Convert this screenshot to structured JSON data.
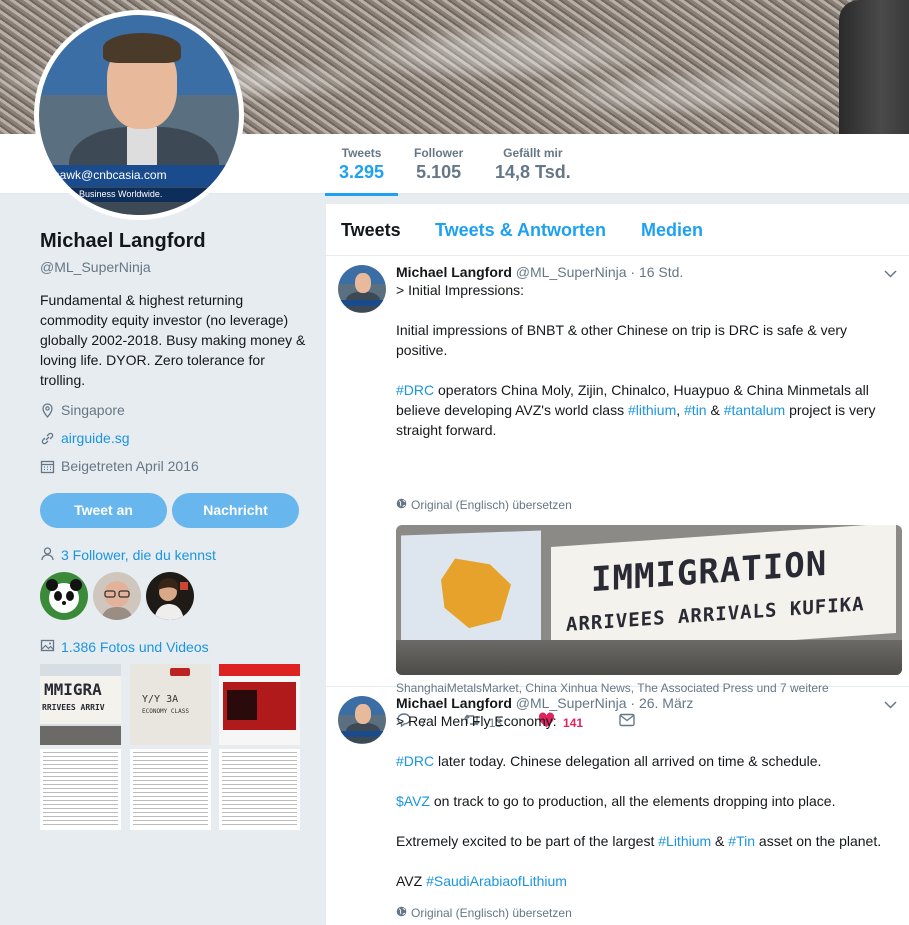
{
  "profile": {
    "name": "Michael Langford",
    "handle": "@ML_SuperNinja",
    "bio": "Fundamental & highest returning commodity equity investor (no leverage) globally 2002-2018. Busy making money & loving life. DYOR. Zero tolerance for trolling.",
    "location": "Singapore",
    "website": "airguide.sg",
    "joined": "Beigetreten April 2016",
    "avatar_ticker": "hawk@cnbcasia.com",
    "avatar_ticker_sub": "Business Worldwide.",
    "tweet_button": "Tweet an",
    "message_button": "Nachricht",
    "followers_you_know": "3 Follower, die du kennst",
    "photos_videos": "1.386 Fotos und Videos"
  },
  "stats": [
    {
      "label": "Tweets",
      "value": "3.295"
    },
    {
      "label": "Follower",
      "value": "5.105"
    },
    {
      "label": "Gefällt mir",
      "value": "14,8 Tsd."
    }
  ],
  "tabs": [
    "Tweets",
    "Tweets & Antworten",
    "Medien"
  ],
  "media_thumbs": {
    "thumb1": "MMIGRA",
    "thumb1b": "RRIVEES ARRIV",
    "thumb2": "Y/Y 3A",
    "thumb2b": "ECONOMY CLASS"
  },
  "tweets": [
    {
      "name": "Michael Langford",
      "handle": "@ML_SuperNinja",
      "time": "· 16 Std.",
      "line1": "> Initial Impressions:",
      "line2": "Initial impressions of BNBT & other Chinese on trip is DRC is safe & very positive.",
      "p3_tag1": "#DRC",
      "p3_a": " operators China Moly, Zijin, Chinalco, Huaypuo & China Minmetals all believe developing AVZ's world class ",
      "p3_tag2": "#lithium",
      "p3_b": ", ",
      "p3_tag3": "#tin",
      "p3_c": " & ",
      "p3_tag4": "#tantalum",
      "p3_d": " project is very straight forward.",
      "translate": "Original (Englisch) übersetzen",
      "media_line1": "IMMIGRATION",
      "media_line2": "ARRIVEES ARRIVALS KUFIKA",
      "credits": "ShanghaiMetalsMarket, China Xinhua News, The Associated Press und 7 weitere",
      "replies": "7",
      "retweets": "13",
      "likes": "141"
    },
    {
      "name": "Michael Langford",
      "handle": "@ML_SuperNinja",
      "time": "· 26. März",
      "line1": "> Real Men Fly Economy:",
      "p2_tag": "#DRC",
      "p2_text": " later today. Chinese delegation all arrived on time & schedule.",
      "p3_tag": "$AVZ",
      "p3_text": " on track to go to production, all the elements dropping into place.",
      "p4_a": "Extremely excited to be part of the largest ",
      "p4_tag1": "#Lithium",
      "p4_b": " & ",
      "p4_tag2": "#Tin",
      "p4_c": " asset on the planet.",
      "p5_a": "AVZ ",
      "p5_tag": "#SaudiArabiaofLithium",
      "translate": "Original (Englisch) übersetzen"
    }
  ],
  "colors": {
    "accent": "#1da1f2",
    "link": "#1b95e0",
    "like": "#e0245e",
    "muted": "#657786"
  }
}
